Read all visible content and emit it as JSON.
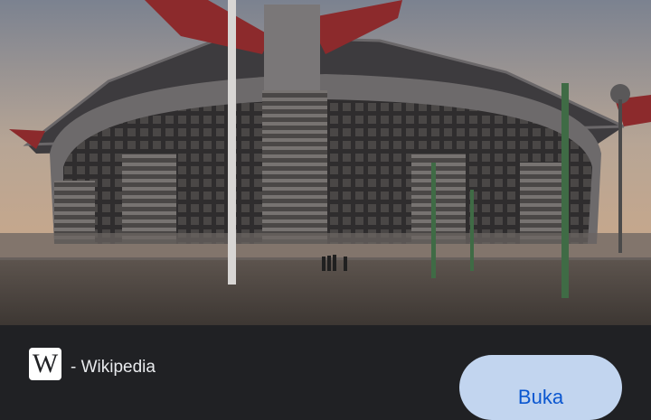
{
  "image": {
    "subject": "stadium-photo"
  },
  "source": {
    "logo_letter": "W",
    "name": "- Wikipedia"
  },
  "actions": {
    "open_label": "Buka"
  },
  "colors": {
    "background": "#202124",
    "button_bg": "#c2d5ef",
    "button_text": "#0b57d0"
  }
}
